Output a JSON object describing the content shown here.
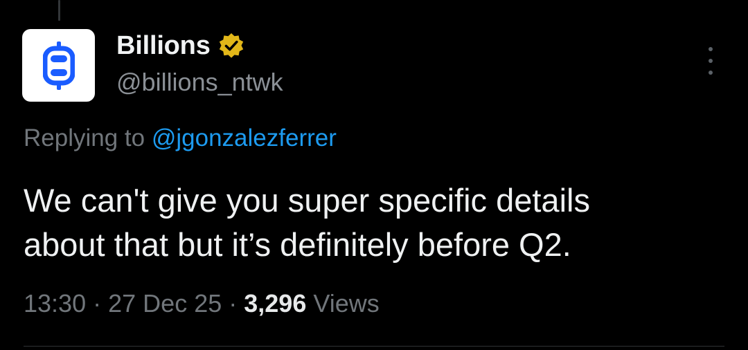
{
  "tweet": {
    "author": {
      "display_name": "Billions",
      "handle": "@billions_ntwk",
      "verified": true,
      "avatar_icon": "billions-logo-icon",
      "verified_icon": "verified-badge-icon"
    },
    "reply": {
      "prefix": "Replying to",
      "to_handle": "@jgonzalezferrer"
    },
    "text_lines": [
      "We can't give you super specific details",
      "about that but it’s definitely before Q2."
    ],
    "meta": {
      "time": "13:30",
      "separator": "·",
      "date": "27 Dec 25",
      "views_count": "3,296",
      "views_label": "Views"
    }
  },
  "colors": {
    "background": "#000000",
    "text": "#e7e9ea",
    "secondary": "#71767b",
    "link": "#1d9bf0",
    "brand_blue": "#1a5cff",
    "verified_gold": "#e2b719"
  }
}
